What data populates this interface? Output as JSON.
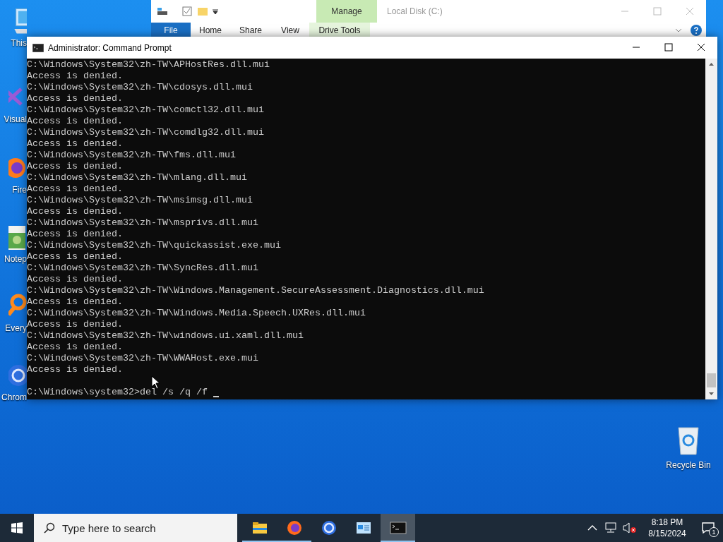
{
  "desktop_icons": [
    {
      "kind": "computer",
      "label": "This"
    },
    {
      "kind": "studio",
      "label": "Visual"
    },
    {
      "kind": "firefox",
      "label": "Fire"
    },
    {
      "kind": "notepad",
      "label": "Notep"
    },
    {
      "kind": "everything",
      "label": "Every"
    },
    {
      "kind": "chrome",
      "label": "Chrom"
    }
  ],
  "recycle_bin": {
    "label": "Recycle Bin"
  },
  "explorer": {
    "title": "Local Disk (C:)",
    "context_group": "Manage",
    "tabs": [
      {
        "label": "File",
        "selected": true
      },
      {
        "label": "Home",
        "selected": false
      },
      {
        "label": "Share",
        "selected": false
      },
      {
        "label": "View",
        "selected": false
      },
      {
        "label": "Drive Tools",
        "selected": false
      }
    ]
  },
  "cmd": {
    "title": "Administrator: Command Prompt",
    "lines": [
      "C:\\Windows\\System32\\zh-TW\\APHostRes.dll.mui",
      "Access is denied.",
      "C:\\Windows\\System32\\zh-TW\\cdosys.dll.mui",
      "Access is denied.",
      "C:\\Windows\\System32\\zh-TW\\comctl32.dll.mui",
      "Access is denied.",
      "C:\\Windows\\System32\\zh-TW\\comdlg32.dll.mui",
      "Access is denied.",
      "C:\\Windows\\System32\\zh-TW\\fms.dll.mui",
      "Access is denied.",
      "C:\\Windows\\System32\\zh-TW\\mlang.dll.mui",
      "Access is denied.",
      "C:\\Windows\\System32\\zh-TW\\msimsg.dll.mui",
      "Access is denied.",
      "C:\\Windows\\System32\\zh-TW\\msprivs.dll.mui",
      "Access is denied.",
      "C:\\Windows\\System32\\zh-TW\\quickassist.exe.mui",
      "Access is denied.",
      "C:\\Windows\\System32\\zh-TW\\SyncRes.dll.mui",
      "Access is denied.",
      "C:\\Windows\\System32\\zh-TW\\Windows.Management.SecureAssessment.Diagnostics.dll.mui",
      "Access is denied.",
      "C:\\Windows\\System32\\zh-TW\\Windows.Media.Speech.UXRes.dll.mui",
      "Access is denied.",
      "C:\\Windows\\System32\\zh-TW\\windows.ui.xaml.dll.mui",
      "Access is denied.",
      "C:\\Windows\\System32\\zh-TW\\WWAHost.exe.mui",
      "Access is denied."
    ],
    "prompt": "C:\\Windows\\system32>",
    "command": "del /s /q /f "
  },
  "taskbar": {
    "search_placeholder": "Type here to search",
    "apps": [
      {
        "kind": "folder",
        "running": true,
        "active": false
      },
      {
        "kind": "firefox",
        "running": true,
        "active": false
      },
      {
        "kind": "chrome",
        "running": false,
        "active": false
      },
      {
        "kind": "panel",
        "running": false,
        "active": false
      },
      {
        "kind": "terminal",
        "running": true,
        "active": true
      }
    ],
    "time": "8:18 PM",
    "date": "8/15/2024",
    "notifications": "1"
  }
}
